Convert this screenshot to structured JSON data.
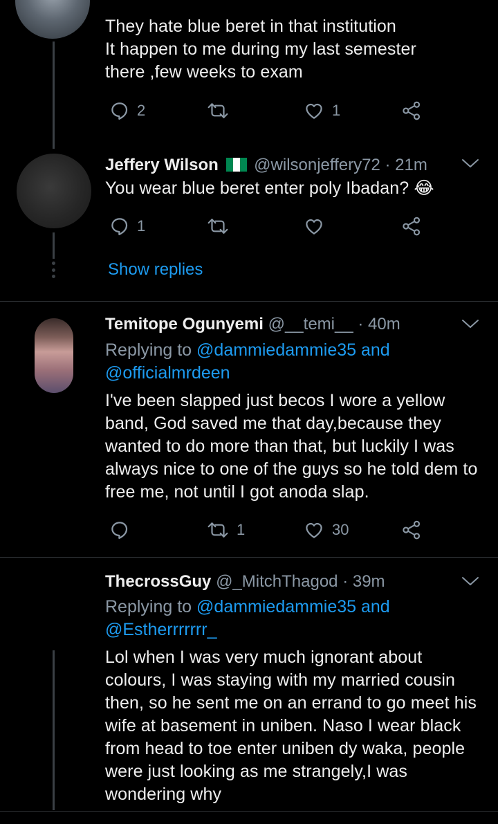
{
  "tweets": [
    {
      "lines": [
        "They hate blue beret in that institution",
        "It happen to me during my last semester",
        "there ,few weeks to exam"
      ],
      "reply_count": "2",
      "retweet_count": "",
      "like_count": "1"
    },
    {
      "name": "Jeffery Wilson",
      "flag": "Nigeria flag",
      "handle": "@wilsonjeffery72",
      "time": "· 21m",
      "lines": [
        "You wear blue beret enter poly Ibadan? 😂"
      ],
      "reply_count": "1",
      "retweet_count": "",
      "like_count": "",
      "show_replies": "Show replies"
    },
    {
      "name": "Temitope Ogunyemi",
      "handle": "@__temi__",
      "time": "· 40m",
      "replying_prefix": "Replying to",
      "replying_line1": "@dammiedammie35 and",
      "replying_line2": "@officialmrdeen",
      "lines": [
        "I've been slapped just becos I wore a yellow",
        "band, God saved me that day,because they",
        "wanted to do more than that, but luckily I was",
        "always nice to one of the guys so he told dem to",
        "free me, not until I got anoda slap."
      ],
      "reply_count": "",
      "retweet_count": "1",
      "like_count": "30"
    },
    {
      "name": "ThecrossGuy",
      "handle": "@_MitchThagod",
      "time": "· 39m",
      "replying_prefix": "Replying to",
      "replying_line1": "@dammiedammie35 and",
      "replying_line2": "@Estherrrrrrr_",
      "lines": [
        "Lol when I was very much ignorant about",
        "colours, I was staying with my married cousin",
        "then, so he sent me on an errand to go meet his",
        "wife at basement in uniben. Naso I wear black",
        "from head to toe enter uniben dy waka, people",
        "were just looking as me strangely,I was",
        "wondering why"
      ]
    }
  ],
  "icons": {
    "reply": "reply-bubble-icon",
    "retweet": "retweet-icon",
    "like": "heart-icon",
    "share": "share-icon",
    "more": "chevron-down-icon"
  },
  "colors": {
    "background": "#000000",
    "text": "#eeeeee",
    "secondary": "#8b98a5",
    "link": "#1d9bf0",
    "divider": "#2f3336"
  }
}
